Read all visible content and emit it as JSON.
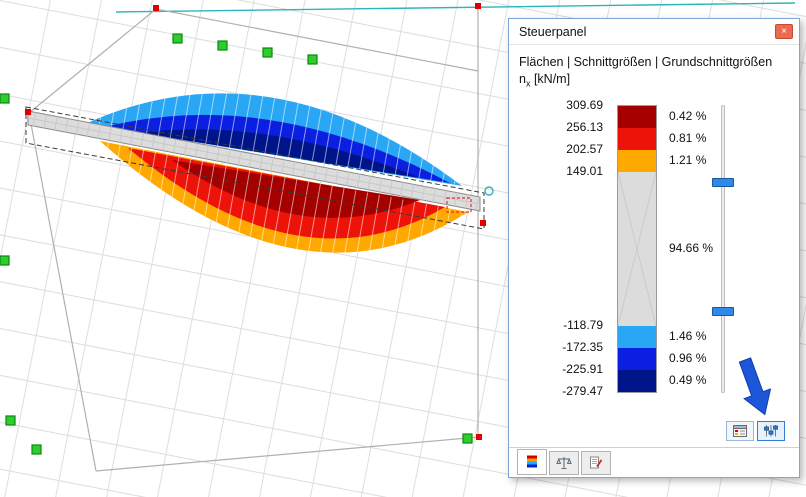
{
  "scene": {
    "support_color": "#2ecc2e",
    "support_border": "#0a8a0a",
    "handle_color": "#e00000",
    "guide_color": "#2ab5bc",
    "selection_color": "#3a3a3a",
    "marker_color": "#e03030"
  },
  "panel": {
    "title": "Steuerpanel",
    "close_glyph": "×",
    "result_path": "Flächen | Schnittgrößen | Grundschnittgrößen",
    "quantity": {
      "symbol": "n",
      "subscript": "x",
      "unit": "[kN/m]"
    },
    "legend": {
      "boundary_values": [
        "309.69",
        "256.13",
        "202.57",
        "149.01",
        "-118.79",
        "-172.35",
        "-225.91",
        "-279.47"
      ],
      "segments": [
        {
          "name": "max-positive",
          "color": "#a50000",
          "percent": "0.42 %"
        },
        {
          "name": "high-positive",
          "color": "#ee1309",
          "percent": "0.81 %"
        },
        {
          "name": "mid-positive",
          "color": "#ffa800",
          "percent": "1.21 %"
        },
        {
          "name": "neutral",
          "color": "#dcdcdc",
          "percent": "94.66 %"
        },
        {
          "name": "mid-negative",
          "color": "#29a7f5",
          "percent": "1.46 %"
        },
        {
          "name": "high-negative",
          "color": "#0b1fe0",
          "percent": "0.96 %"
        },
        {
          "name": "max-negative",
          "color": "#001489",
          "percent": "0.49 %"
        }
      ]
    },
    "slider": {
      "color": "#2e8ae6"
    },
    "buttons": [
      {
        "name": "panel-options"
      },
      {
        "name": "display-filters"
      }
    ],
    "tabs": [
      {
        "name": "color-scale"
      },
      {
        "name": "factors"
      },
      {
        "name": "filter"
      }
    ]
  },
  "annotation": {
    "arrow_color": "#1d56d8"
  }
}
